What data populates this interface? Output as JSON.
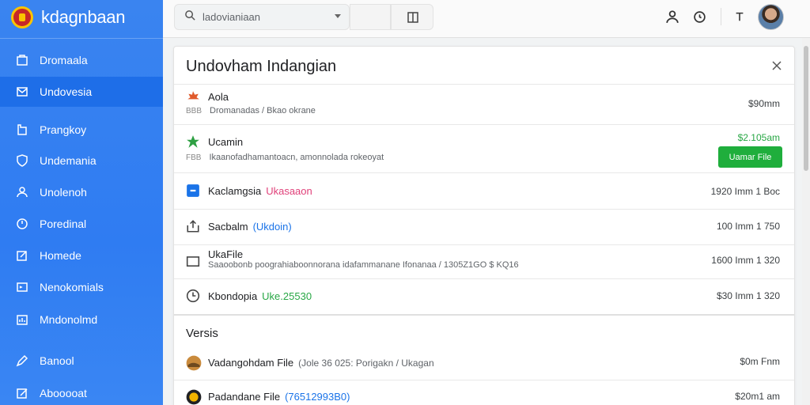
{
  "app": {
    "name": "kdagnbaan"
  },
  "sidebar": {
    "items": [
      {
        "label": "Dromaala",
        "icon": "briefcase-icon"
      },
      {
        "label": "Undovesia",
        "icon": "mail-icon",
        "active": true
      },
      {
        "label": "Prangkoy",
        "icon": "book-icon"
      },
      {
        "label": "Undemania",
        "icon": "shield-icon"
      },
      {
        "label": "Unolenoh",
        "icon": "users-icon"
      },
      {
        "label": "Poredinal",
        "icon": "clock-icon"
      },
      {
        "label": "Homede",
        "icon": "edit-icon"
      },
      {
        "label": "Nenokomials",
        "icon": "terminal-icon"
      },
      {
        "label": "Mndonolmd",
        "icon": "chart-icon"
      },
      {
        "label": "Banool",
        "icon": "pen-icon"
      },
      {
        "label": "Abooooat",
        "icon": "square-pen-icon"
      }
    ]
  },
  "topbar": {
    "search_value": "ladovianiaan",
    "icons": [
      "user-icon",
      "info-icon",
      "filter-icon"
    ]
  },
  "panel": {
    "title": "Undovham Indangian",
    "rows": [
      {
        "title": "Aola",
        "sub_prefix": "BBB",
        "sub": "Dromanadas / Bkao okrane",
        "value": "$90mm",
        "icon": "leaf-icon"
      },
      {
        "title": "Ucamin",
        "sub_prefix": "FBB",
        "sub": "Ikaanofadhamantoacn, amonnolada rokeoyat",
        "value": "$2.105am",
        "button": "Uamar File",
        "icon": "clover-icon"
      },
      {
        "title": "Kaclamgsia",
        "tag": "Ukasaaon",
        "value": "1920 Imm 1 Boc",
        "icon": "app-icon"
      },
      {
        "title": "Sacbalm",
        "tag": "(Ukdoin)",
        "value": "100 Imm 1 750",
        "icon": "upload-icon"
      },
      {
        "title": "UkaFile",
        "sub": "Saaoobonb poograhiaboonnorana idafammanane Ifonanaa / 1305Z1GO $ KQ16",
        "value": "1600 Imm 1 320",
        "icon": "folder-icon"
      },
      {
        "title": "Kbondopia",
        "tag": "Uke.25530",
        "value": "$30 Imm 1 320",
        "icon": "timer-icon"
      }
    ],
    "section": "Versis",
    "section_rows": [
      {
        "title": "Vadangohdam File",
        "tag": "(Jole 36 025: Porigakn / Ukagan",
        "value": "$0m Fnm",
        "icon": "globe-icon"
      },
      {
        "title": "Padandane File",
        "tag": "(76512993B0)",
        "value": "$20m1 am",
        "icon": "badge-icon"
      }
    ]
  },
  "colors": {
    "sidebar": "#2f7cf2",
    "active": "#1e6ee8",
    "green": "#1fae3c"
  }
}
